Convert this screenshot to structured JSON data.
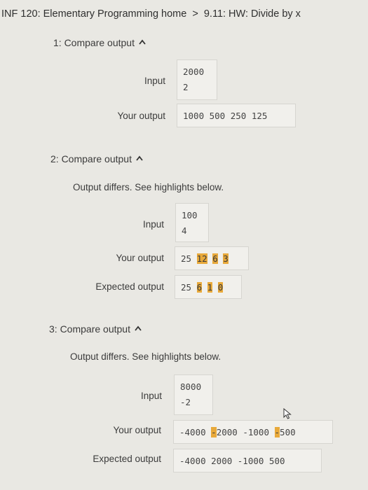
{
  "breadcrumb": {
    "course": "INF 120: Elementary Programming home",
    "separator": ">",
    "section": "9.11: HW: Divide by x"
  },
  "tests": [
    {
      "header": "1: Compare output",
      "diff_message": "",
      "input_label": "Input",
      "input_lines": [
        "2000",
        "2"
      ],
      "your_output_label": "Your output",
      "your_output": "1000 500 250 125",
      "expected_output_label": "",
      "expected_output": ""
    },
    {
      "header": "2: Compare output",
      "diff_message": "Output differs. See highlights below.",
      "input_label": "Input",
      "input_lines": [
        "100",
        "4"
      ],
      "your_output_label": "Your output",
      "your_output_tokens": [
        "25",
        "12",
        "6",
        "3"
      ],
      "expected_output_label": "Expected output",
      "expected_output_tokens": [
        "25",
        "6",
        "1",
        "0"
      ]
    },
    {
      "header": "3: Compare output",
      "diff_message": "Output differs. See highlights below.",
      "input_label": "Input",
      "input_lines": [
        "8000",
        "-2"
      ],
      "your_output_label": "Your output",
      "your_output_tokens": [
        "-4000",
        "-",
        "2000",
        "-1000",
        "-",
        "500"
      ],
      "expected_output_label": "Expected output",
      "expected_output": "-4000 2000 -1000 500"
    }
  ],
  "colors": {
    "background": "#e9e8e3",
    "highlight": "#e8a93a",
    "box_background": "#f1f0ec"
  },
  "icons": {
    "collapse": "chevron-up-icon",
    "cursor": "mouse-pointer-icon"
  }
}
